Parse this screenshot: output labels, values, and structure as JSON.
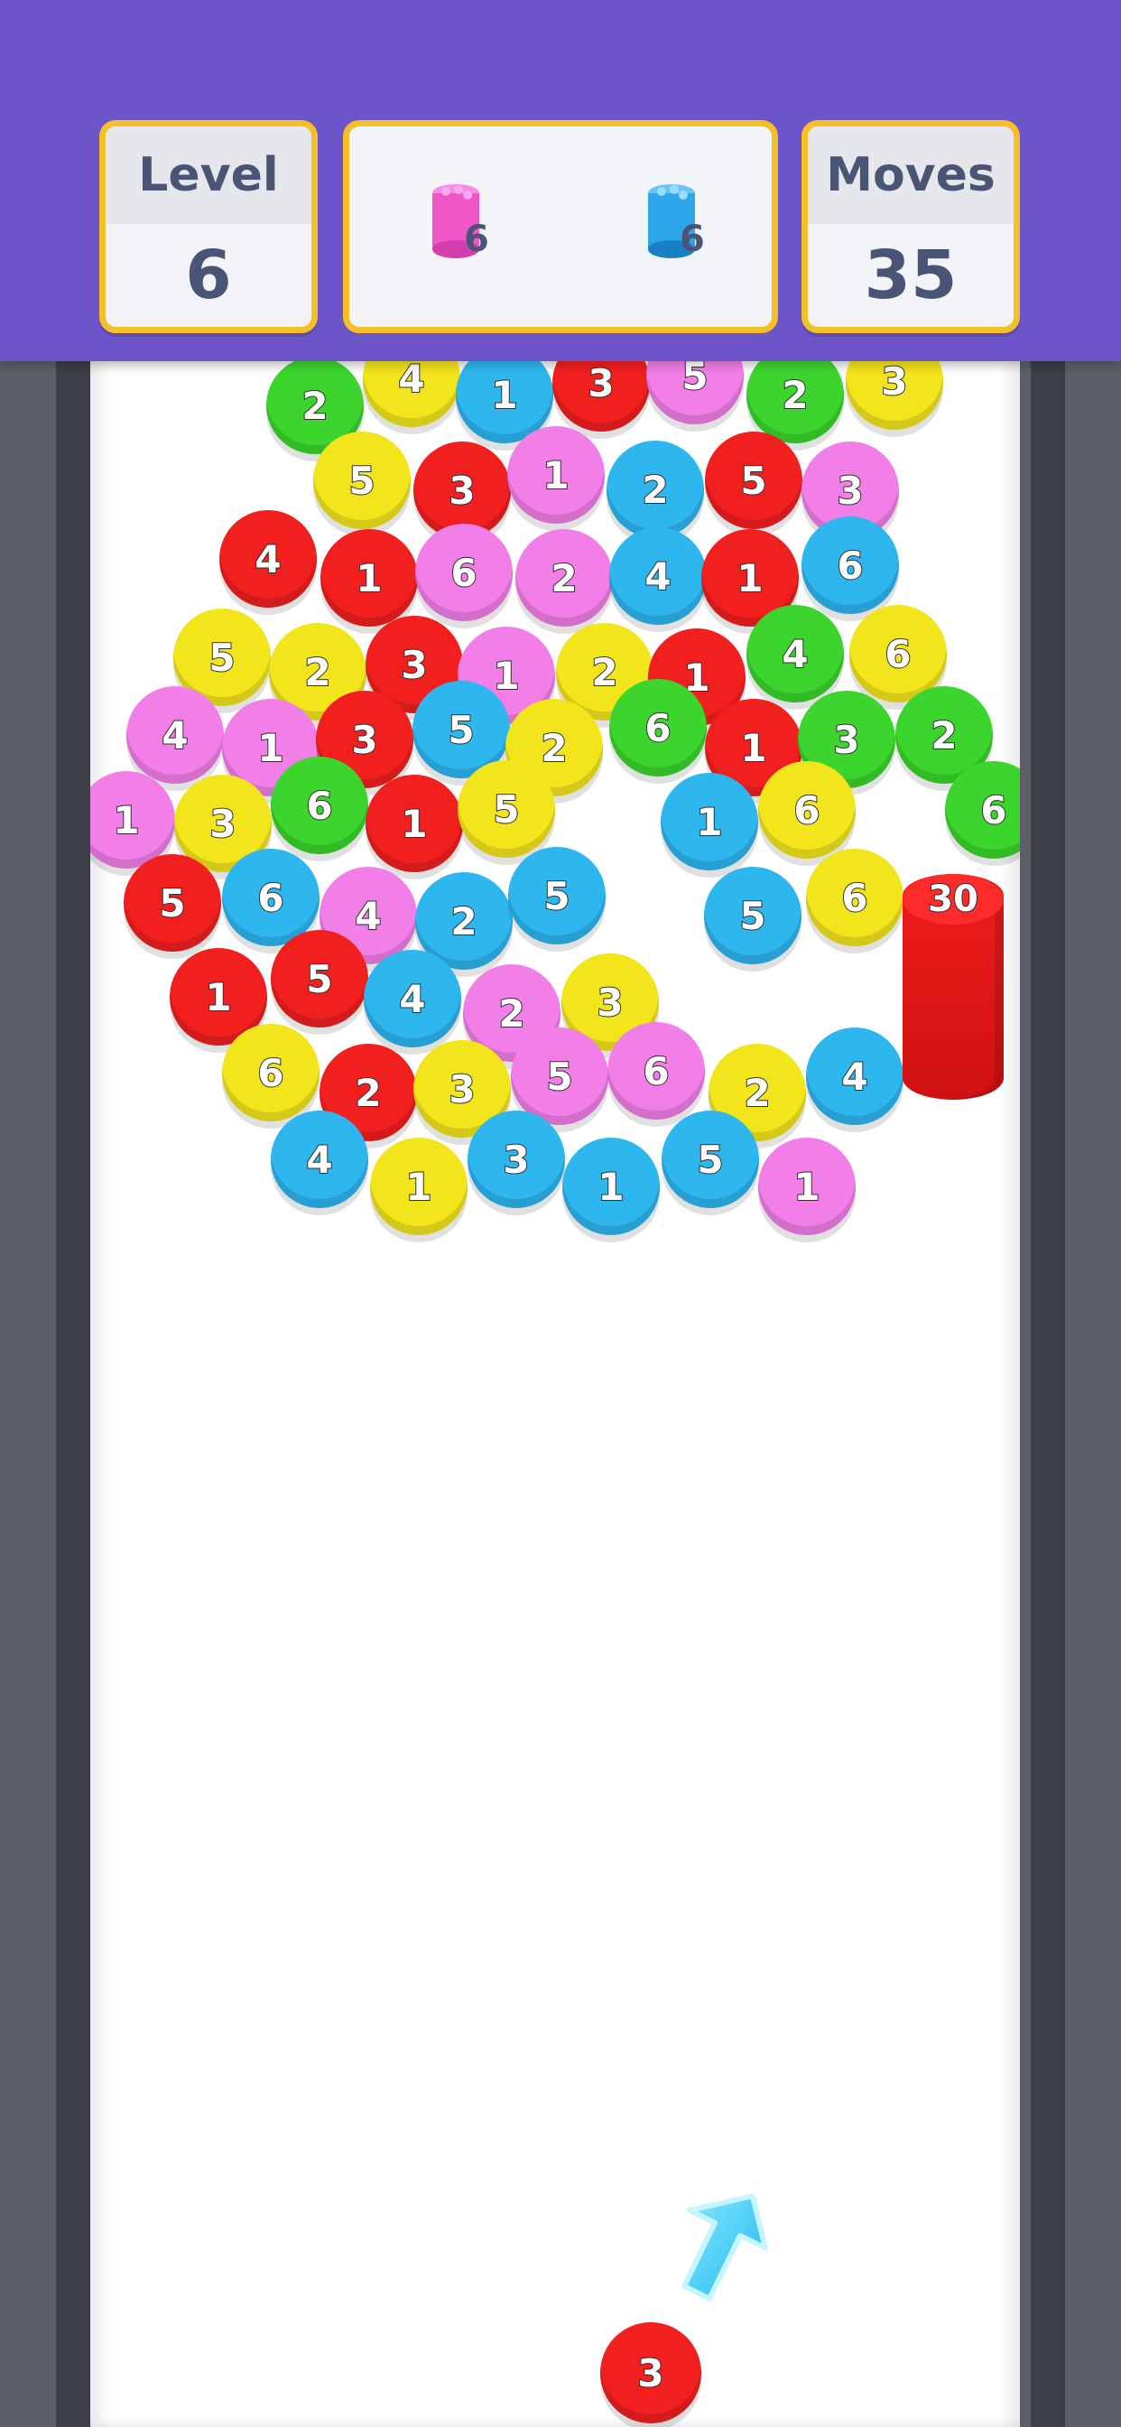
{
  "hud": {
    "level_label": "Level",
    "level_value": "6",
    "moves_label": "Moves",
    "moves_value": "35"
  },
  "goals": [
    {
      "color": "#ef57c9",
      "count": "6",
      "icon": "pink-stack-icon"
    },
    {
      "color": "#2ea7ea",
      "count": "6",
      "icon": "blue-stack-icon"
    }
  ],
  "palette": {
    "red": "#f21f1f",
    "yellow": "#f2e51c",
    "green": "#3bd52d",
    "blue": "#2eb6ef",
    "pink": "#f27ee7"
  },
  "board_chips": [
    {
      "n": "2",
      "c": "green"
    },
    {
      "n": "4",
      "c": "yellow"
    },
    {
      "n": "1",
      "c": "blue"
    },
    {
      "n": "3",
      "c": "red"
    },
    {
      "n": "5",
      "c": "pink"
    },
    {
      "n": "2",
      "c": "green"
    },
    {
      "n": "3",
      "c": "yellow"
    },
    {
      "n": "5",
      "c": "yellow"
    },
    {
      "n": "3",
      "c": "red"
    },
    {
      "n": "1",
      "c": "pink"
    },
    {
      "n": "2",
      "c": "blue"
    },
    {
      "n": "5",
      "c": "red"
    },
    {
      "n": "3",
      "c": "pink"
    },
    {
      "n": "4",
      "c": "red"
    },
    {
      "n": "1",
      "c": "red"
    },
    {
      "n": "6",
      "c": "pink"
    },
    {
      "n": "2",
      "c": "pink"
    },
    {
      "n": "4",
      "c": "blue"
    },
    {
      "n": "1",
      "c": "red"
    },
    {
      "n": "6",
      "c": "blue"
    },
    {
      "n": "5",
      "c": "yellow"
    },
    {
      "n": "2",
      "c": "yellow"
    },
    {
      "n": "3",
      "c": "red"
    },
    {
      "n": "1",
      "c": "pink"
    },
    {
      "n": "2",
      "c": "yellow"
    },
    {
      "n": "1",
      "c": "red"
    },
    {
      "n": "4",
      "c": "green"
    },
    {
      "n": "6",
      "c": "yellow"
    },
    {
      "n": "4",
      "c": "pink"
    },
    {
      "n": "1",
      "c": "pink"
    },
    {
      "n": "3",
      "c": "red"
    },
    {
      "n": "5",
      "c": "blue"
    },
    {
      "n": "2",
      "c": "yellow"
    },
    {
      "n": "6",
      "c": "green"
    },
    {
      "n": "1",
      "c": "red"
    },
    {
      "n": "3",
      "c": "green"
    },
    {
      "n": "2",
      "c": "green"
    },
    {
      "n": "1",
      "c": "pink"
    },
    {
      "n": "3",
      "c": "yellow"
    },
    {
      "n": "6",
      "c": "green"
    },
    {
      "n": "1",
      "c": "red"
    },
    {
      "n": "5",
      "c": "yellow"
    },
    {
      "n": "1",
      "c": "blue"
    },
    {
      "n": "6",
      "c": "yellow"
    },
    {
      "n": "6",
      "c": "green"
    },
    {
      "n": "5",
      "c": "red"
    },
    {
      "n": "6",
      "c": "blue"
    },
    {
      "n": "4",
      "c": "pink"
    },
    {
      "n": "2",
      "c": "blue"
    },
    {
      "n": "5",
      "c": "blue"
    },
    {
      "n": "5",
      "c": "blue"
    },
    {
      "n": "6",
      "c": "yellow"
    },
    {
      "n": "1",
      "c": "red"
    },
    {
      "n": "5",
      "c": "red"
    },
    {
      "n": "4",
      "c": "blue"
    },
    {
      "n": "2",
      "c": "pink"
    },
    {
      "n": "3",
      "c": "yellow"
    },
    {
      "n": "6",
      "c": "yellow"
    },
    {
      "n": "2",
      "c": "red"
    },
    {
      "n": "3",
      "c": "yellow"
    },
    {
      "n": "5",
      "c": "pink"
    },
    {
      "n": "6",
      "c": "pink"
    },
    {
      "n": "2",
      "c": "yellow"
    },
    {
      "n": "4",
      "c": "blue"
    },
    {
      "n": "4",
      "c": "blue"
    },
    {
      "n": "1",
      "c": "yellow"
    },
    {
      "n": "3",
      "c": "blue"
    },
    {
      "n": "1",
      "c": "blue"
    },
    {
      "n": "5",
      "c": "blue"
    },
    {
      "n": "1",
      "c": "pink"
    }
  ],
  "tower": {
    "count": "30",
    "color": "#f21f1f"
  },
  "player": {
    "value": "3",
    "color": "#f21f1f"
  }
}
